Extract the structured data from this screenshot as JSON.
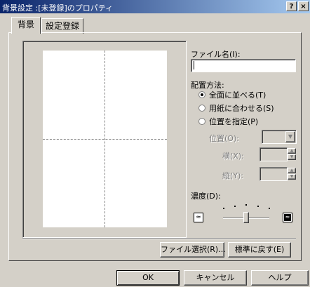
{
  "window": {
    "title": "背景設定 :[未登録]のプロパティ",
    "help_button": "?",
    "close_button": "×"
  },
  "tabs": [
    {
      "label": "背景",
      "active": true
    },
    {
      "label": "設定登録",
      "active": false
    }
  ],
  "file": {
    "label": "ファイル名(I):",
    "value": ""
  },
  "layout": {
    "label": "配置方法:",
    "options": [
      {
        "label": "全面に並べる(T)",
        "checked": true,
        "enabled": true
      },
      {
        "label": "用紙に合わせる(S)",
        "checked": false,
        "enabled": true
      },
      {
        "label": "位置を指定(P)",
        "checked": false,
        "enabled": true
      }
    ],
    "position_label": "位置(O):",
    "position_value": "",
    "width_label": "横(X):",
    "width_value": "",
    "height_label": "縦(Y):",
    "height_value": ""
  },
  "density": {
    "label": "濃度(D):",
    "level_fraction": 0.5
  },
  "buttons": {
    "select_file": "ファイル選択(R)...",
    "reset_default": "標準に戻す(E)",
    "ok": "OK",
    "cancel": "キャンセル",
    "help": "ヘルプ"
  },
  "icons": {
    "density_low": "light-pattern-icon",
    "density_high": "dark-pattern-icon",
    "combo_arrow": "chevron-down-icon",
    "spin_up": "spin-up-icon",
    "spin_down": "spin-down-icon"
  }
}
